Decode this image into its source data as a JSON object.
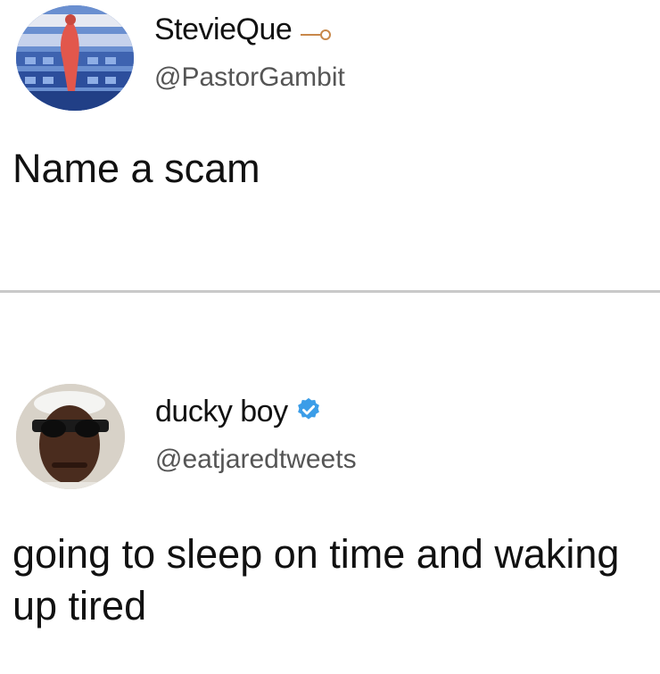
{
  "tweets": [
    {
      "display_name": "StevieQue",
      "handle": "@PastorGambit",
      "text": "Name a scam",
      "name_icon": "pin-icon"
    },
    {
      "display_name": "ducky boy",
      "handle": "@eatjaredtweets",
      "text": "going to sleep on time and waking up tired",
      "name_icon": "verified-badge-icon"
    }
  ]
}
